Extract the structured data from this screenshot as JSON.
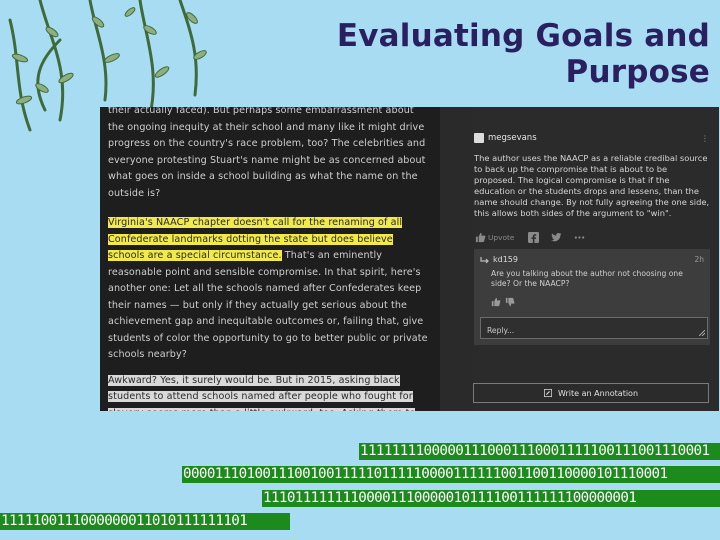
{
  "slide": {
    "title": "Evaluating Goals and Purpose"
  },
  "article": {
    "para1": "their actually faced). But perhaps some embarrassment about the ongoing inequity at their school and many like it might drive progress on the country's race problem, too? The celebrities and everyone protesting Stuart's name might be as concerned about what goes on inside a school building as what the name on the outside is?",
    "para2_highlighted": "Virginia's NAACP chapter doesn't call for the renaming of all Confederate landmarks dotting the state but does believe schools are a special circumstance.",
    "para2_rest": " That's an eminently reasonable point and sensible compromise. In that spirit, here's another one: Let all the schools named after Confederates keep their names — but only if they actually get serious about the achievement gap and inequitable outcomes or, failing that, give students of color the opportunity to go to better public or private schools nearby?",
    "para3_highlighted": "Awkward? Yes, it surely would be. But in 2015, asking black students to attend schools named after people who fought for slavery seems more than a little awkward, too. Asking them to attend"
  },
  "annotation": {
    "username": "megsevans",
    "menu_glyph": "⋮",
    "text": "The author uses the NAACP as a reliable credibal source to back up the compromise that is about to be proposed. The logical compromise is that if the education or the students drops and lessens, than the name should change. By not fully agreeing the one side, this allows both sides of the argument to \"win\".",
    "upvote_label": "Upvote",
    "icons": [
      "thumbs-up-icon",
      "facebook-icon",
      "twitter-icon",
      "more-icon"
    ]
  },
  "reply": {
    "username": "kd159",
    "menu_glyph": "2h",
    "text": "Are you talking about the author not choosing one side? Or the NAACP?",
    "input_placeholder": "Reply...",
    "icons": [
      "thumbs-up-icon",
      "thumbs-down-icon"
    ]
  },
  "write_button": {
    "label": "Write an Annotation",
    "icon": "pencil-icon"
  },
  "binary": {
    "row1": "11111111000001110001110001111100111001110001",
    "row2": "0000111010011100100111110111110000111111001100110000101110001",
    "row3": "11101111111100001110000010111100111111100000001",
    "row4": "1111100111000000011010111111101"
  },
  "colors": {
    "title": "#2a2060",
    "slide_background": "#a8dcf2",
    "highlight": "#f2e94a",
    "binary_band": "#1d8a1d"
  }
}
